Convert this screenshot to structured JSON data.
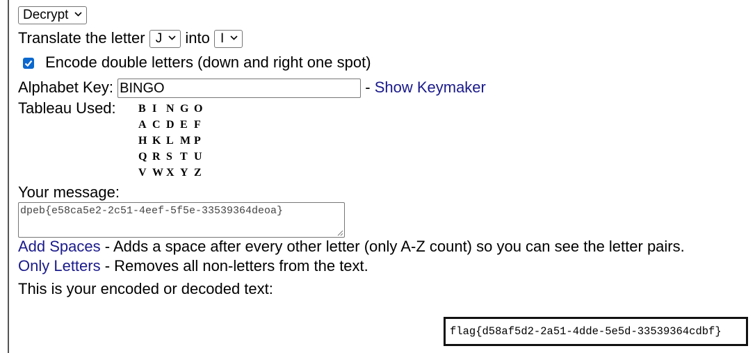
{
  "mode_select": {
    "value": "Decrypt"
  },
  "translate": {
    "prefix": "Translate the letter",
    "from_value": "J",
    "middle": "into",
    "to_value": "I"
  },
  "double_letters": {
    "checked": true,
    "label": "Encode double letters (down and right one spot)"
  },
  "alphabet_key": {
    "label": "Alphabet Key:",
    "value": "BINGO",
    "separator": "-",
    "keymaker_link": "Show Keymaker"
  },
  "tableau": {
    "label": "Tableau Used:",
    "rows": [
      [
        "B",
        "I",
        "N",
        "G",
        "O"
      ],
      [
        "A",
        "C",
        "D",
        "E",
        "F"
      ],
      [
        "H",
        "K",
        "L",
        "M",
        "P"
      ],
      [
        "Q",
        "R",
        "S",
        "T",
        "U"
      ],
      [
        "V",
        "W",
        "X",
        "Y",
        "Z"
      ]
    ]
  },
  "message": {
    "label": "Your message:",
    "value": "dpeb{e58ca5e2-2c51-4eef-5f5e-33539364deoa}"
  },
  "add_spaces": {
    "link": "Add Spaces",
    "description": "- Adds a space after every other letter (only A-Z count) so you can see the letter pairs."
  },
  "only_letters": {
    "link": "Only Letters",
    "description": "- Removes all non-letters from the text."
  },
  "result": {
    "label": "This is your encoded or decoded text:",
    "value": "flag{d58af5d2-2a51-4dde-5e5d-33539364cdbf}"
  },
  "colors": {
    "link": "#1a1a8c",
    "checkbox": "#0b68cf"
  }
}
